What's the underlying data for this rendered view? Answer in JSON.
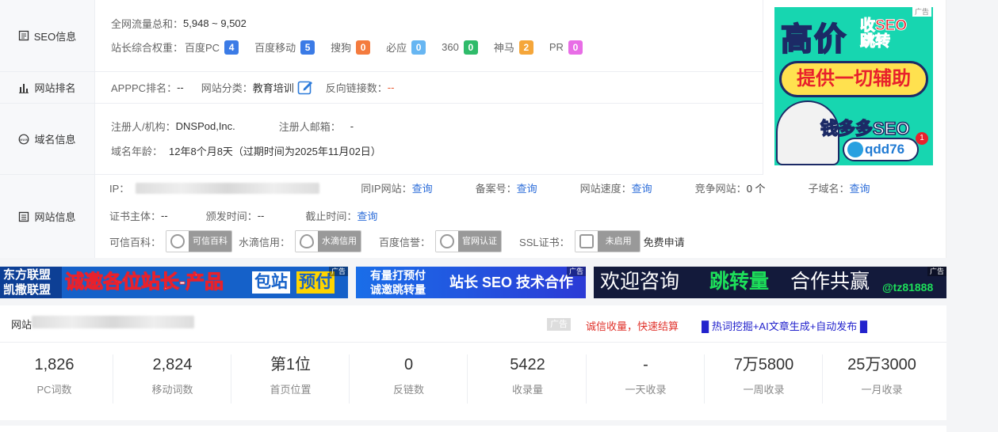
{
  "seo_info": {
    "label": "SEO信息",
    "traffic_label": "全网流量总和：",
    "traffic_value": "5,948 ~ 9,502",
    "weights_label": "站长综合权重：",
    "weights": [
      {
        "name": "百度PC",
        "value": "4",
        "color": "#3b7be6"
      },
      {
        "name": "百度移动",
        "value": "5",
        "color": "#3b7be6"
      },
      {
        "name": "搜狗",
        "value": "0",
        "color": "#f47b3e"
      },
      {
        "name": "必应",
        "value": "0",
        "color": "#67b6f2"
      },
      {
        "name": "360",
        "value": "0",
        "color": "#2fbb6a"
      },
      {
        "name": "神马",
        "value": "2",
        "color": "#f5a63a"
      },
      {
        "name": "PR",
        "value": "0",
        "color": "#e86de6"
      }
    ]
  },
  "rank": {
    "label": "网站排名",
    "apppc_label": "APPPC排名：",
    "apppc_value": "--",
    "category_label": "网站分类：",
    "category_value": "教育培训",
    "backlinks_label": "反向链接数：",
    "backlinks_value": "--"
  },
  "domain": {
    "label": "域名信息",
    "registrant_label": "注册人/机构：",
    "registrant_value": "DNSPod,Inc.",
    "email_label": "注册人邮箱：",
    "email_value": "-",
    "age_label": "域名年龄：",
    "age_value": "12年8个月8天（过期时间为2025年11月02日）"
  },
  "site": {
    "label": "网站信息",
    "ip_label": "IP：",
    "same_ip_label": "同IP网站：",
    "same_ip_link": "查询",
    "icp_label": "备案号：",
    "icp_link": "查询",
    "speed_label": "网站速度：",
    "speed_link": "查询",
    "competitor_label": "竞争网站：",
    "competitor_value": "0 个",
    "subdomain_label": "子域名：",
    "subdomain_link": "查询",
    "cert_owner_label": "证书主体：",
    "cert_owner_value": "--",
    "issue_label": "颁发时间：",
    "issue_value": "--",
    "expire_label": "截止时间：",
    "expire_link": "查询",
    "kexin_label": "可信百科：",
    "kexin_tag": "可信百科",
    "shuidi_label": "水滴信用：",
    "shuidi_tag": "水滴信用",
    "baidu_label": "百度信誉：",
    "baidu_tag": "官网认证",
    "ssl_label": "SSL证书：",
    "ssl_tag": "未启用",
    "ssl_apply": "免费申请"
  },
  "ad_right": {
    "tag": "广告",
    "big": "高价",
    "red_line1": "收SEO",
    "red_line2": "跳转",
    "pill": "提供一切辅助",
    "money": "钱多多SEO",
    "tg": "qdd76",
    "notif": "1"
  },
  "banners": [
    {
      "text_left_1": "东方联盟",
      "text_left_2": "凯撒联盟",
      "main": "诚邀各位站长-产品",
      "b1": "包站",
      "b2": "预付",
      "tag": "广告"
    },
    {
      "l1": "有量打预付",
      "l2": "诚邀跳转量",
      "main": "站长 SEO 技术合作",
      "tag": "广告"
    },
    {
      "main1": "欢迎咨询",
      "main2": "跳转量",
      "main3": "合作共赢",
      "handle": "@tz81888",
      "tag": "广告"
    }
  ],
  "stats_head": {
    "site_prefix": "网站",
    "ad_tag": "广告",
    "link_red": "诚信收量，快速结算",
    "link_blue": "█ 热词挖掘+AI文章生成+自动发布 █"
  },
  "stats": [
    {
      "num": "1,826",
      "cap": "PC词数"
    },
    {
      "num": "2,824",
      "cap": "移动词数"
    },
    {
      "num": "第1位",
      "cap": "首页位置"
    },
    {
      "num": "0",
      "cap": "反链数"
    },
    {
      "num": "5422",
      "cap": "收录量"
    },
    {
      "num": "-",
      "cap": "一天收录"
    },
    {
      "num": "7万5800",
      "cap": "一周收录"
    },
    {
      "num": "25万3000",
      "cap": "一月收录"
    }
  ]
}
